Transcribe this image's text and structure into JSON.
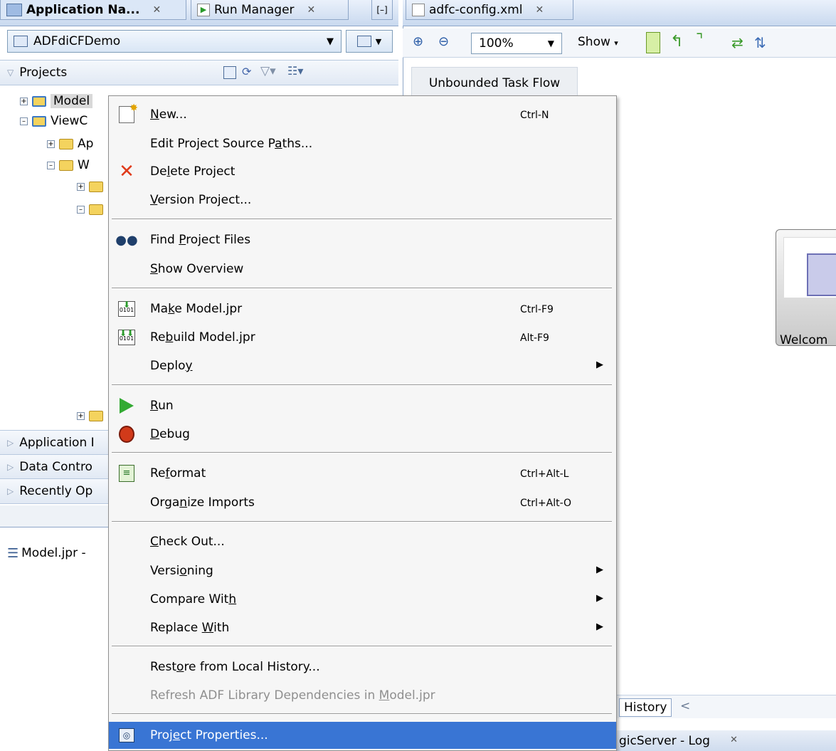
{
  "left_tabs": [
    {
      "label": "Application Na..."
    },
    {
      "label": "Run Manager"
    }
  ],
  "right_tabs": [
    {
      "label": "adfc-config.xml"
    }
  ],
  "app_selector": {
    "value": "ADFdiCFDemo"
  },
  "projects_panel": {
    "title": "Projects"
  },
  "tree": [
    {
      "label": "Model",
      "depth": 0
    },
    {
      "label": "ViewC",
      "depth": 0
    },
    {
      "label": "Ap",
      "depth": 1
    },
    {
      "label": "W",
      "depth": 1
    }
  ],
  "accordions": [
    {
      "label": "Application I"
    },
    {
      "label": "Data Contro"
    },
    {
      "label": "Recently Op"
    }
  ],
  "structure_tab": {
    "label": "Model.jpr -"
  },
  "editor_toolbar": {
    "zoom": "100%",
    "show_label": "Show"
  },
  "unbounded_tab": "Unbounded Task Flow",
  "diagram_node": {
    "label": "Welcom"
  },
  "history_tab": "History",
  "log_tab": "gicServer - Log",
  "context_menu": {
    "items": [
      {
        "pre": "",
        "u": "N",
        "post": "ew...",
        "shortcut": "Ctrl-N",
        "icon": "new-icon"
      },
      {
        "pre": "Edit Project Source P",
        "u": "a",
        "post": "ths...",
        "shortcut": "",
        "icon": ""
      },
      {
        "pre": "De",
        "u": "l",
        "post": "ete Project",
        "shortcut": "",
        "icon": "delete-icon"
      },
      {
        "pre": "",
        "u": "V",
        "post": "ersion Project...",
        "shortcut": "",
        "icon": ""
      },
      {
        "pre": "Find ",
        "u": "P",
        "post": "roject Files",
        "shortcut": "",
        "icon": "binoculars-icon"
      },
      {
        "pre": "",
        "u": "S",
        "post": "how Overview",
        "shortcut": "",
        "icon": ""
      },
      {
        "pre": "Ma",
        "u": "k",
        "post": "e Model.jpr",
        "shortcut": "Ctrl-F9",
        "icon": "make-icon"
      },
      {
        "pre": "Re",
        "u": "b",
        "post": "uild Model.jpr",
        "shortcut": "Alt-F9",
        "icon": "rebuild-icon"
      },
      {
        "pre": "Deplo",
        "u": "y",
        "post": "",
        "shortcut": "",
        "icon": ""
      },
      {
        "pre": "",
        "u": "R",
        "post": "un",
        "shortcut": "",
        "icon": "run-icon"
      },
      {
        "pre": "",
        "u": "D",
        "post": "ebug",
        "shortcut": "",
        "icon": "debug-icon"
      },
      {
        "pre": "Re",
        "u": "f",
        "post": "ormat",
        "shortcut": "Ctrl+Alt-L",
        "icon": "reformat-icon"
      },
      {
        "pre": "Orga",
        "u": "n",
        "post": "ize Imports",
        "shortcut": "Ctrl+Alt-O",
        "icon": ""
      },
      {
        "pre": "",
        "u": "C",
        "post": "heck Out...",
        "shortcut": "",
        "icon": ""
      },
      {
        "pre": "Versi",
        "u": "o",
        "post": "ning",
        "shortcut": "",
        "icon": ""
      },
      {
        "pre": "Compare Wit",
        "u": "h",
        "post": "",
        "shortcut": "",
        "icon": ""
      },
      {
        "pre": "Replace ",
        "u": "W",
        "post": "ith",
        "shortcut": "",
        "icon": ""
      },
      {
        "pre": "Rest",
        "u": "o",
        "post": "re from Local History...",
        "shortcut": "",
        "icon": ""
      },
      {
        "pre": "Refresh ADF Library Dependencies in ",
        "u": "M",
        "post": "odel.jpr",
        "shortcut": "",
        "icon": ""
      },
      {
        "pre": "Proj",
        "u": "e",
        "post": "ct Properties...",
        "shortcut": "",
        "icon": "properties-icon"
      }
    ]
  },
  "colors": {
    "selection": "#3975d4",
    "menu_bg": "#f6f6f6",
    "tab_blue": "#dbe7f7"
  }
}
